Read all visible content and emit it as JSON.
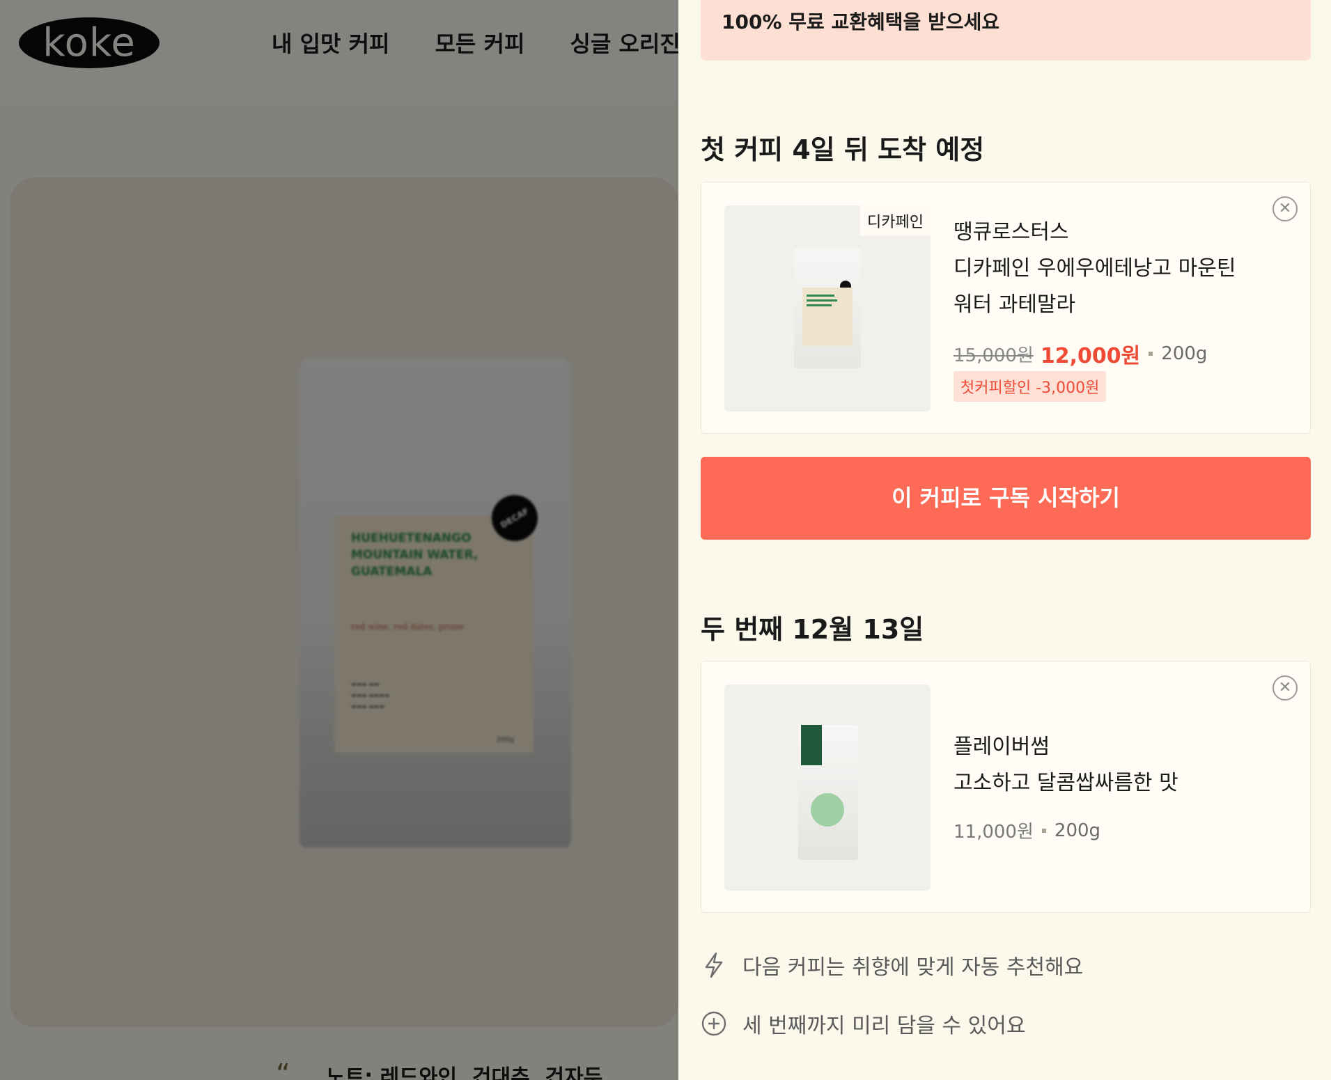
{
  "background": {
    "logo": "koke",
    "nav": [
      "내 입맛 커피",
      "모든 커피",
      "싱글 오리진"
    ],
    "product_bag": {
      "badge": "DECAF",
      "label_title": "HUEHUETENANGO MOUNTAIN WATER, GUATEMALA",
      "weight": "200g",
      "notes": "red wine, red dates, prune"
    },
    "note_quote_mark": "“",
    "note_text": "노트: 레드와인, 건대추, 건자두"
  },
  "panel": {
    "promo_text": "100% 무료 교환혜택을 받으세요",
    "first": {
      "title": "첫 커피 4일 뒤 도착 예정",
      "tag": "디카페인",
      "brand": "땡큐로스터스",
      "name_line1": "디카페인 우에우에테낭고 마운틴",
      "name_line2": "워터 과테말라",
      "price_old": "15,000원",
      "price_new": "12,000원",
      "weight": "200g",
      "discount": "첫커피할인 -3,000원",
      "remove_icon": "close-circle-icon"
    },
    "cta_label": "이 커피로 구독 시작하기",
    "second": {
      "title": "두 번째 12월 13일",
      "brand": "플레이버썸",
      "name_line1": "고소하고 달콤쌉싸름한 맛",
      "price": "11,000원",
      "weight": "200g",
      "remove_icon": "close-circle-icon"
    },
    "info": [
      {
        "icon": "lightning-icon",
        "text": "다음 커피는 취향에 맞게 자동 추천해요"
      },
      {
        "icon": "plus-circle-icon",
        "text": "세 번째까지 미리 담을 수 있어요"
      }
    ]
  },
  "colors": {
    "accent": "#fd6a55",
    "price_red": "#ee4a36",
    "promo_bg": "#fde0d3",
    "panel_bg": "#fbf8ec"
  }
}
